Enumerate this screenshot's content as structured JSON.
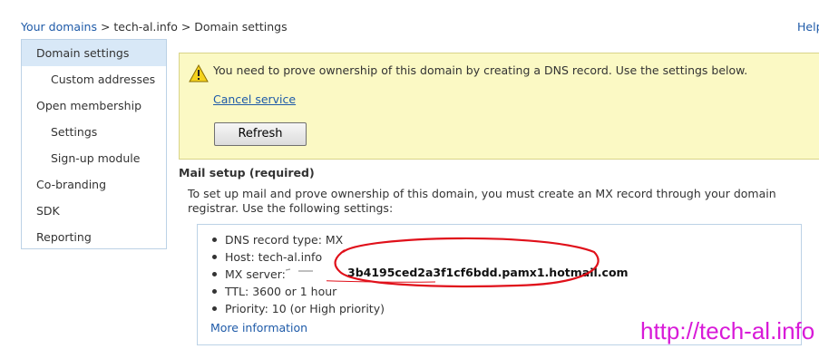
{
  "breadcrumb": {
    "root": "Your domains",
    "sep1": " > ",
    "domain": "tech-al.info",
    "sep2": " > ",
    "current": "Domain settings"
  },
  "header": {
    "help": "Help"
  },
  "sidebar": {
    "items": [
      {
        "label": "Domain settings",
        "selected": true
      },
      {
        "label": "Custom addresses"
      },
      {
        "label": "Open membership"
      },
      {
        "label": "Settings"
      },
      {
        "label": "Sign-up module"
      },
      {
        "label": "Co-branding"
      },
      {
        "label": "SDK"
      },
      {
        "label": "Reporting"
      }
    ]
  },
  "warning": {
    "icon": "warning-icon",
    "message": "You need to prove ownership of this domain by creating a DNS record. Use the settings below.",
    "cancel_link": "Cancel service",
    "refresh_button": "Refresh",
    "background_color": "#fbf9c4"
  },
  "mail_setup": {
    "heading": "Mail setup (required)",
    "description": "To set up mail and prove ownership of this domain, you must create an MX record through your domain registrar. Use the following settings:",
    "settings": [
      "DNS record type: MX",
      "Host: tech-al.info",
      "MX server:",
      "TTL: 3600 or 1 hour",
      "Priority: 10 (or High priority)"
    ],
    "mx_server_value": "3b4195ced2a3f1cf6bdd.pamx1.hotmail.com",
    "more_info": "More information"
  },
  "watermark": "http://tech-al.info",
  "colors": {
    "link": "#1e5aa8",
    "selected_nav": "#d8e8f7",
    "annotation": "#e0101a",
    "watermark": "#d81ad8"
  }
}
